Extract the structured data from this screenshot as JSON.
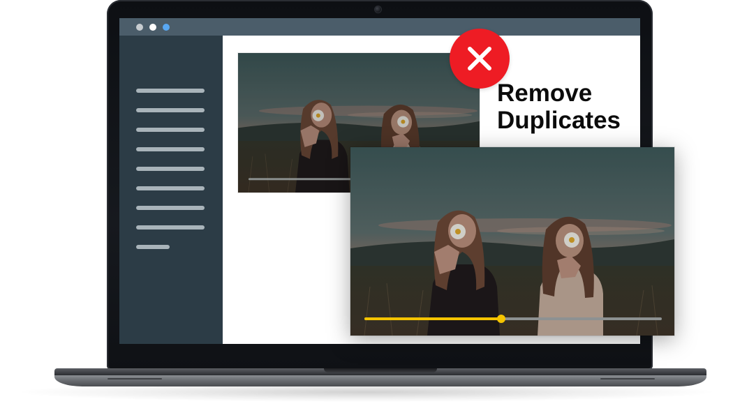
{
  "app": {
    "window_controls": [
      {
        "name": "window-dot-gray",
        "color": "#c7ccd0"
      },
      {
        "name": "window-dot-white",
        "color": "#ffffff"
      },
      {
        "name": "window-dot-blue",
        "color": "#59a8f3"
      }
    ],
    "sidebar": {
      "item_count": 9
    }
  },
  "promo": {
    "headline_line1": "Remove",
    "headline_line2": "Duplicates",
    "badge_icon": "close-icon",
    "badge_color": "#ee1c24"
  },
  "media": {
    "duplicate_thumbnail": {
      "description_icon": "photo-thumbnail",
      "progress": 0.0
    },
    "original_thumbnail": {
      "description_icon": "photo-thumbnail",
      "progress": 0.46,
      "progress_color": "#f5c400"
    }
  }
}
